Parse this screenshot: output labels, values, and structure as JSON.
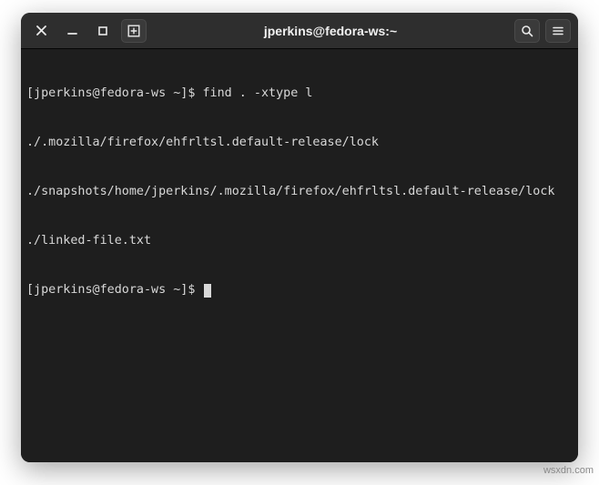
{
  "titlebar": {
    "title": "jperkins@fedora-ws:~",
    "close_icon": "close-icon",
    "minimize_icon": "minimize-icon",
    "maximize_icon": "maximize-icon",
    "newtab_icon": "new-tab-icon",
    "search_icon": "search-icon",
    "menu_icon": "hamburger-menu-icon"
  },
  "terminal": {
    "lines": [
      "[jperkins@fedora-ws ~]$ find . -xtype l",
      "./.mozilla/firefox/ehfrltsl.default-release/lock",
      "./snapshots/home/jperkins/.mozilla/firefox/ehfrltsl.default-release/lock",
      "./linked-file.txt"
    ],
    "prompt": "[jperkins@fedora-ws ~]$ "
  },
  "watermark": "wsxdn.com"
}
